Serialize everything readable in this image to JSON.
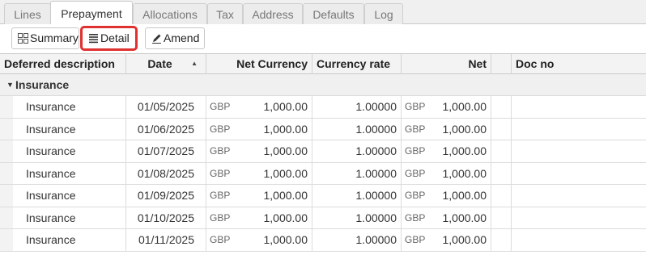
{
  "tabs": [
    {
      "label": "Lines"
    },
    {
      "label": "Prepayment"
    },
    {
      "label": "Allocations"
    },
    {
      "label": "Tax"
    },
    {
      "label": "Address"
    },
    {
      "label": "Defaults"
    },
    {
      "label": "Log"
    }
  ],
  "active_tab": "Prepayment",
  "toolbar": {
    "summary_label": "Summary",
    "detail_label": "Detail",
    "amend_label": "Amend"
  },
  "columns": {
    "deferred_description": "Deferred description",
    "date": "Date",
    "net_currency": "Net Currency",
    "currency_rate": "Currency rate",
    "net": "Net",
    "doc_no": "Doc no"
  },
  "group": {
    "label": "Insurance"
  },
  "rows": [
    {
      "description": "Insurance",
      "date": "01/05/2025",
      "net_currency_code": "GBP",
      "net_currency_amount": "1,000.00",
      "currency_rate": "1.00000",
      "net_code": "GBP",
      "net_amount": "1,000.00",
      "doc_no": ""
    },
    {
      "description": "Insurance",
      "date": "01/06/2025",
      "net_currency_code": "GBP",
      "net_currency_amount": "1,000.00",
      "currency_rate": "1.00000",
      "net_code": "GBP",
      "net_amount": "1,000.00",
      "doc_no": ""
    },
    {
      "description": "Insurance",
      "date": "01/07/2025",
      "net_currency_code": "GBP",
      "net_currency_amount": "1,000.00",
      "currency_rate": "1.00000",
      "net_code": "GBP",
      "net_amount": "1,000.00",
      "doc_no": ""
    },
    {
      "description": "Insurance",
      "date": "01/08/2025",
      "net_currency_code": "GBP",
      "net_currency_amount": "1,000.00",
      "currency_rate": "1.00000",
      "net_code": "GBP",
      "net_amount": "1,000.00",
      "doc_no": ""
    },
    {
      "description": "Insurance",
      "date": "01/09/2025",
      "net_currency_code": "GBP",
      "net_currency_amount": "1,000.00",
      "currency_rate": "1.00000",
      "net_code": "GBP",
      "net_amount": "1,000.00",
      "doc_no": ""
    },
    {
      "description": "Insurance",
      "date": "01/10/2025",
      "net_currency_code": "GBP",
      "net_currency_amount": "1,000.00",
      "currency_rate": "1.00000",
      "net_code": "GBP",
      "net_amount": "1,000.00",
      "doc_no": ""
    },
    {
      "description": "Insurance",
      "date": "01/11/2025",
      "net_currency_code": "GBP",
      "net_currency_amount": "1,000.00",
      "currency_rate": "1.00000",
      "net_code": "GBP",
      "net_amount": "1,000.00",
      "doc_no": ""
    }
  ],
  "icons": {
    "summary": "grid-icon",
    "detail": "list-icon",
    "amend": "pencil-icon",
    "sort": "sort-ascending-icon",
    "group_toggle": "caret-down-icon"
  },
  "colors": {
    "highlight": "#e03131"
  }
}
